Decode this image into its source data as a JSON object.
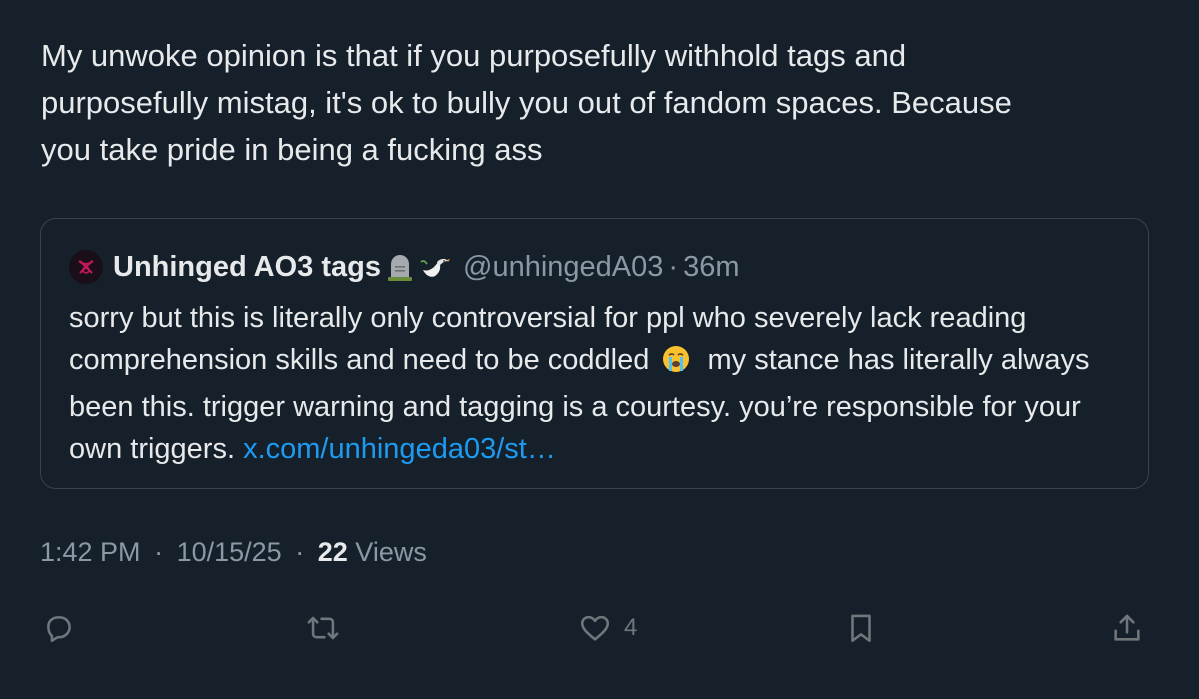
{
  "tweet": {
    "text": "My unwoke opinion is that if you purposefully withhold tags and\npurposefully mistag, it's ok to bully you out of fandom spaces. Because\nyou take pride in being a fucking ass"
  },
  "quote": {
    "display_name": "Unhinged AO3 tags",
    "name_emojis": [
      "headstone-emoji",
      "dove-emoji"
    ],
    "handle": "@unhingedA03",
    "separator": "·",
    "time": "36m",
    "text_part1": "sorry but this is literally only controversial for ppl who severely lack reading comprehension skills and need to be coddled",
    "text_emoji": "loudly-crying-face-emoji",
    "text_part2": "my stance has literally always been this. trigger warning and tagging is a courtesy. you’re responsible for your own triggers. ",
    "link": "x.com/unhingeda03/st…"
  },
  "meta": {
    "time": "1:42 PM",
    "date": "10/15/25",
    "separator": "·",
    "views_count": "22",
    "views_label": "Views"
  },
  "actions": {
    "reply_icon": "reply-icon",
    "retweet_icon": "retweet-icon",
    "like_icon": "heart-icon",
    "like_count": "4",
    "bookmark_icon": "bookmark-icon",
    "share_icon": "share-icon"
  },
  "colors": {
    "background": "#15202b",
    "text": "#e7e9ea",
    "secondary": "#8b98a5",
    "link": "#1d9bf0",
    "border": "#38444d"
  }
}
